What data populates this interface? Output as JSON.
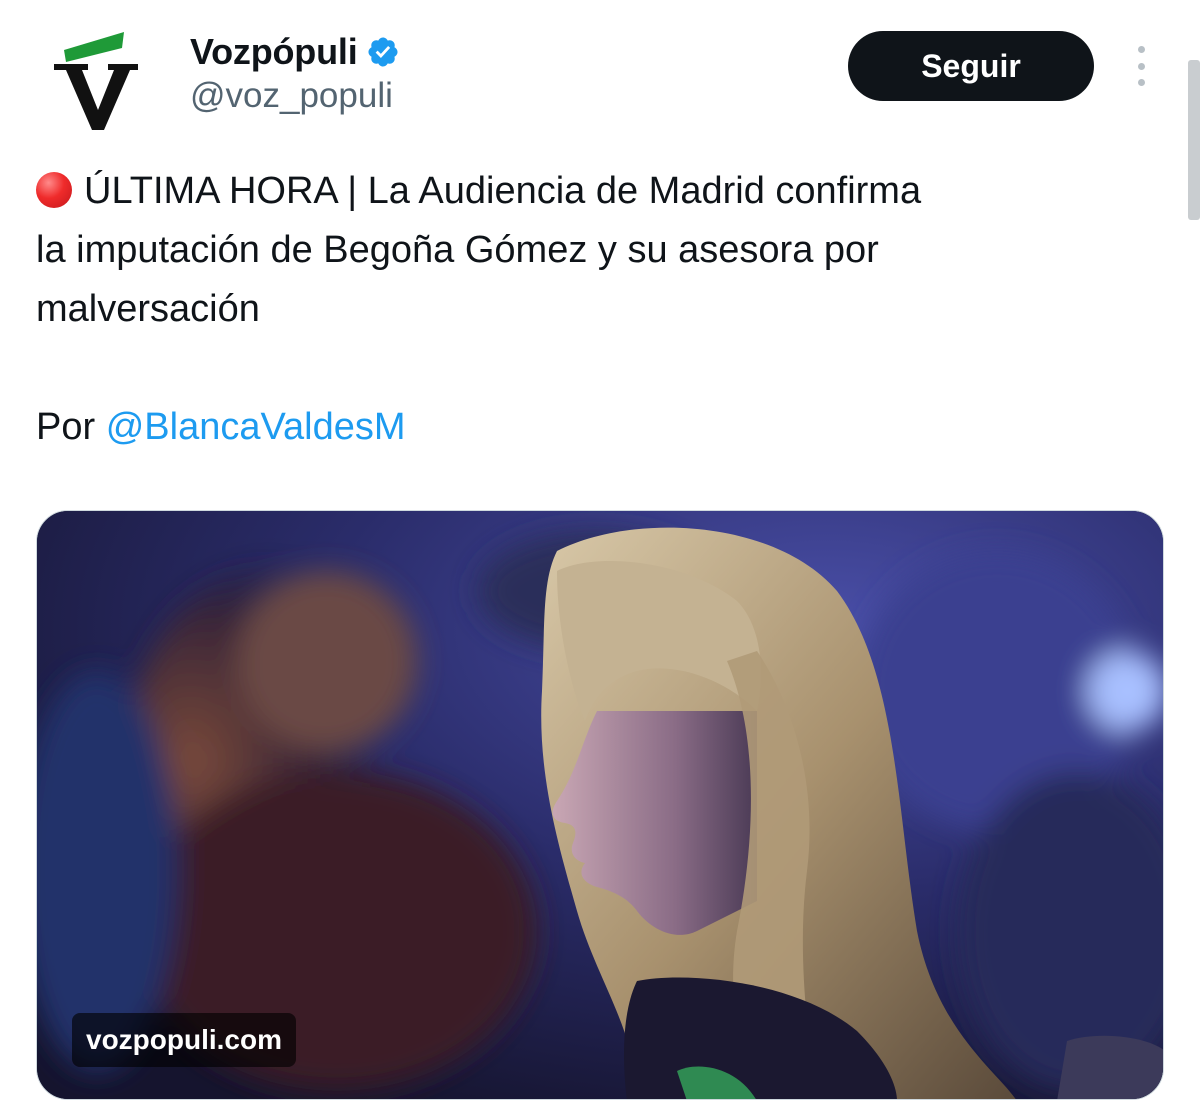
{
  "author": {
    "display_name": "Vozpópuli",
    "handle": "@voz_populi",
    "verified": true,
    "avatar_icon": "vozpopuli-logo-icon"
  },
  "actions": {
    "follow_label": "Seguir",
    "more_icon": "more-vertical-icon"
  },
  "tweet": {
    "status_icon": "red-circle-emoji",
    "text_lines": [
      "ÚLTIMA HORA | La Audiencia de Madrid confirma",
      "la imputación de Begoña Gómez y su asesora por",
      "malversación"
    ],
    "byline_prefix": "Por",
    "mention": "@BlancaValdesM"
  },
  "media": {
    "domain": "vozpopuli.com",
    "image": "photo-woman-profile-blue-background"
  },
  "colors": {
    "text": "#0f1419",
    "secondary": "#536471",
    "link": "#1d9bf0",
    "verified": "#1d9bf0",
    "button_bg": "#0f1419",
    "logo_green": "#1f9a38"
  }
}
